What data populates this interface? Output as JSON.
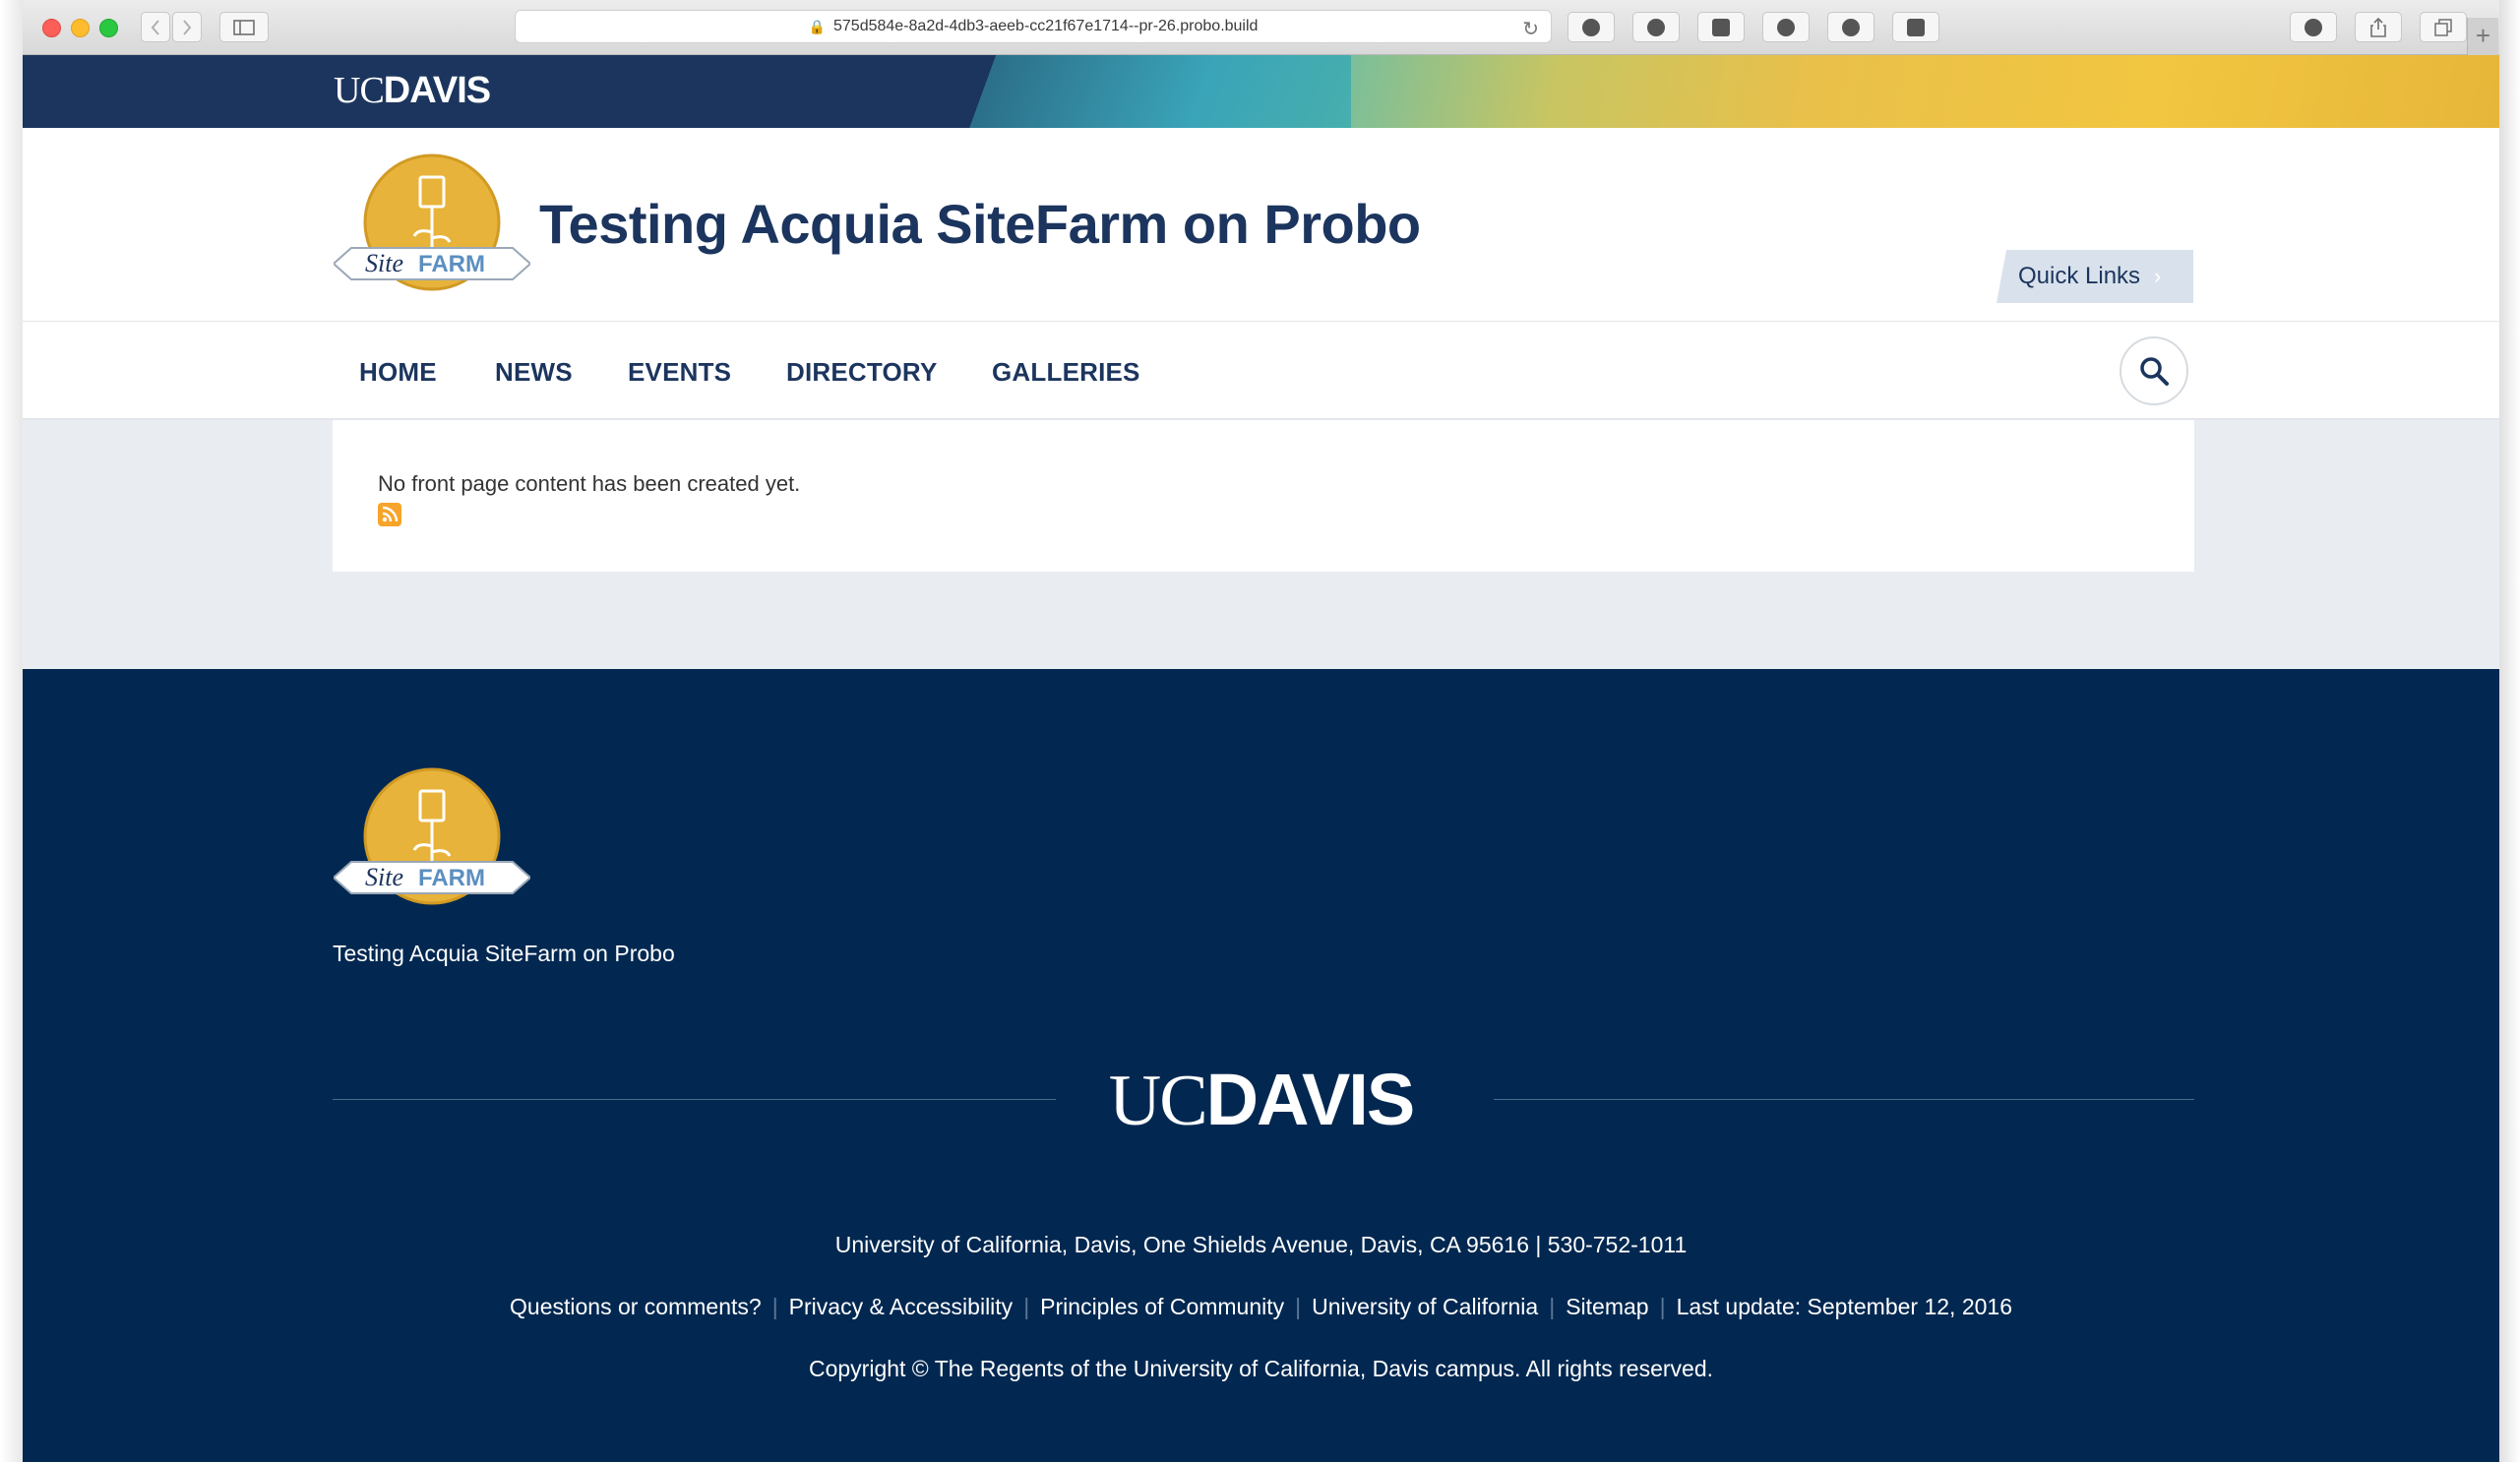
{
  "browser": {
    "url": "575d584e-8a2d-4db3-aeeb-cc21f67e1714--pr-26.probo.build"
  },
  "banner": {
    "logo_uc": "UC",
    "logo_davis": "DAVIS"
  },
  "header": {
    "logo_text_site": "Site",
    "logo_text_farm": "FARM",
    "title": "Testing Acquia SiteFarm on Probo",
    "quick_links": "Quick Links"
  },
  "nav": {
    "items": [
      "HOME",
      "NEWS",
      "EVENTS",
      "DIRECTORY",
      "GALLERIES"
    ]
  },
  "content": {
    "message": "No front page content has been created yet."
  },
  "footer": {
    "site_name": "Testing Acquia SiteFarm on Probo",
    "uc": "UC",
    "davis": "DAVIS",
    "address": "University of California, Davis, One Shields Avenue, Davis, CA 95616 | 530-752-1011",
    "links": [
      "Questions or comments?",
      "Privacy & Accessibility",
      "Principles of Community",
      "University of California",
      "Sitemap",
      "Last update: September 12, 2016"
    ],
    "copyright": "Copyright © The Regents of the University of California, Davis campus. All rights reserved."
  },
  "colors": {
    "navy": "#1c355e",
    "footer_navy": "#022851",
    "gold": "#e8b33a",
    "rss": "#f7a42b"
  }
}
